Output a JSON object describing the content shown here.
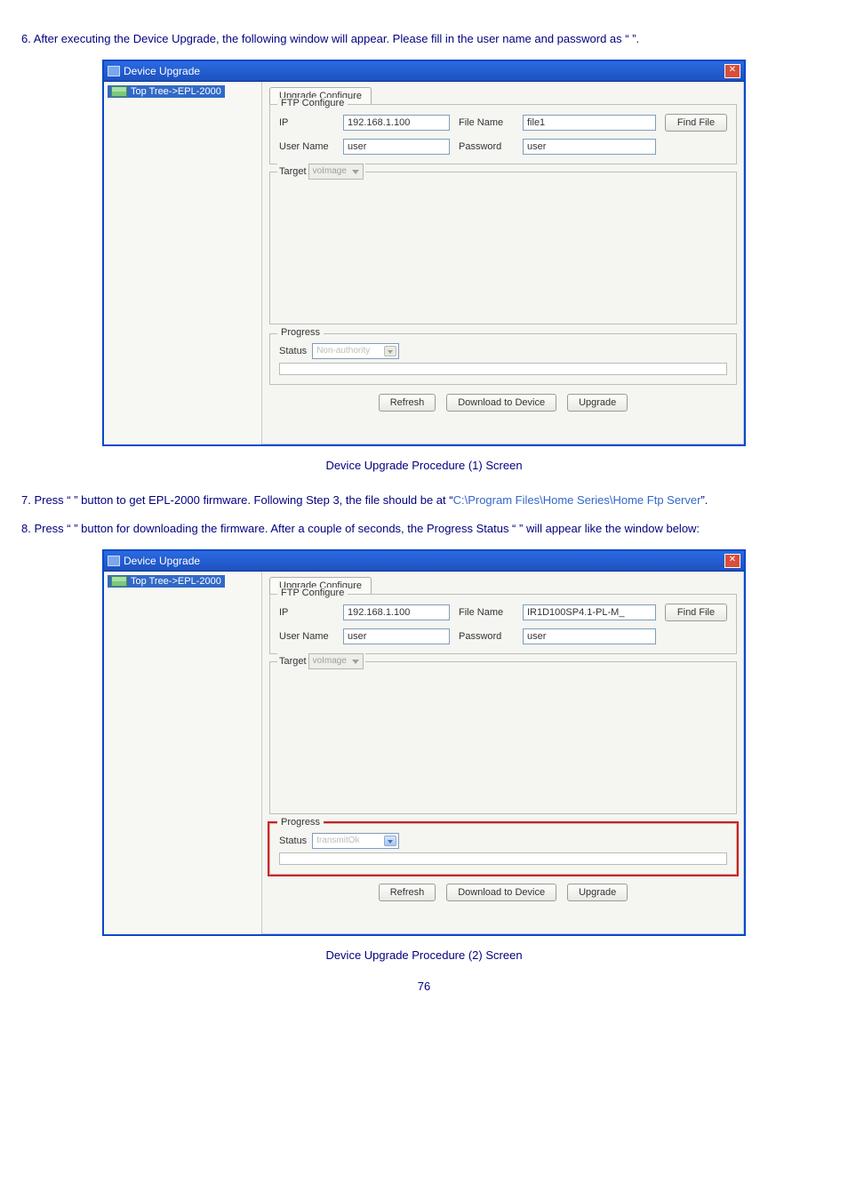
{
  "step6": {
    "text": "6. After executing the Device Upgrade, the following window will appear. Please fill in the user name and password as “       ”."
  },
  "caption1": "Device Upgrade Procedure (1) Screen",
  "step7_a": "7. Press “              ” button to get EPL-2000 firmware. Following Step 3, the file should be at “",
  "step7_b": "C:\\Program Files\\Home Series\\Home Ftp Server",
  "step7_c": "”.",
  "step8": "8. Press “                                 ” button for downloading the firmware. After a couple of seconds, the Progress Status “                   ” will appear like the window below:",
  "caption2": "Device Upgrade Procedure (2) Screen",
  "page_number": "76",
  "win_title": "Device Upgrade",
  "tree_item": "Top Tree->EPL-2000",
  "tab_label": "Upgrade Configure",
  "ftp": {
    "legend": "FTP Configure",
    "ip_label": "IP",
    "ip_value": "192.168.1.100",
    "filename_label": "File Name",
    "filename1": "file1",
    "filename2": "IR1D100SP4.1-PL-M_",
    "findfile": "Find File",
    "user_label": "User Name",
    "user_value": "user",
    "pw_label": "Password",
    "pw_value": "user"
  },
  "target": {
    "label": "Target",
    "value": "voImage"
  },
  "progress": {
    "legend": "Progress",
    "status_label": "Status",
    "status1": "Non-authority",
    "status2": "transmitOk"
  },
  "buttons": {
    "refresh": "Refresh",
    "download": "Download to Device",
    "upgrade": "Upgrade"
  }
}
